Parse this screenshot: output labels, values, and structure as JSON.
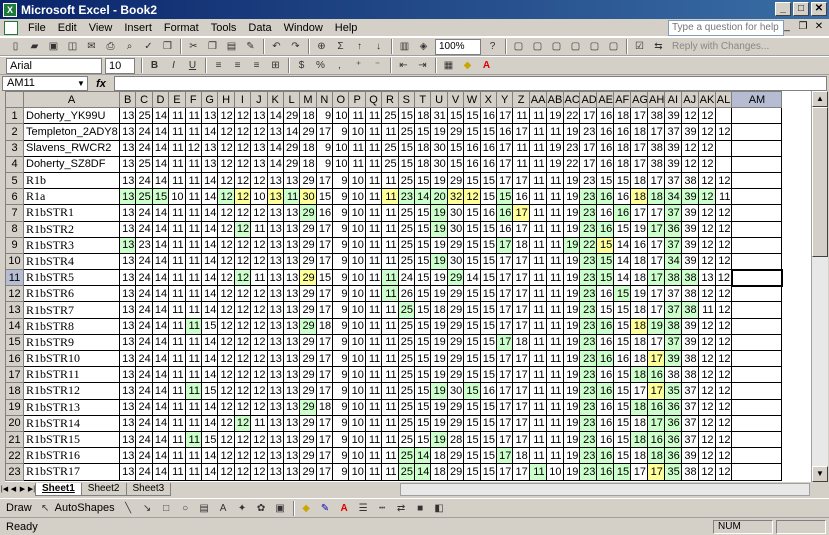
{
  "window": {
    "title": "Microsoft Excel - Book2"
  },
  "menu": [
    "File",
    "Edit",
    "View",
    "Insert",
    "Format",
    "Tools",
    "Data",
    "Window",
    "Help"
  ],
  "help_placeholder": "Type a question for help",
  "toolbar": {
    "zoom": "100%",
    "reply_label": "Reply with Changes...",
    "font": "Arial",
    "size": "10"
  },
  "formula": {
    "cell_ref": "AM11",
    "fx": "fx",
    "value": ""
  },
  "columns": [
    "A",
    "B",
    "C",
    "D",
    "E",
    "F",
    "G",
    "H",
    "I",
    "J",
    "K",
    "L",
    "M",
    "N",
    "O",
    "P",
    "Q",
    "R",
    "S",
    "T",
    "U",
    "V",
    "W",
    "X",
    "Y",
    "Z",
    "AA",
    "AB",
    "AC",
    "AD",
    "AE",
    "AF",
    "AG",
    "AH",
    "AI",
    "AJ",
    "AK",
    "AL",
    "AM"
  ],
  "rows": [
    {
      "n": "1",
      "name": "Doherty_YK99U",
      "v": [
        "13",
        "25",
        "14",
        "11",
        "11",
        "13",
        "12",
        "12",
        "13",
        "14",
        "29",
        "18",
        "9",
        "10",
        "11",
        "11",
        "25",
        "15",
        "18",
        "31",
        "15",
        "15",
        "16",
        "17",
        "11",
        "11",
        "19",
        "22",
        "17",
        "16",
        "18",
        "17",
        "38",
        "39",
        "12",
        "12"
      ]
    },
    {
      "n": "2",
      "name": "Templeton_2ADY8",
      "v": [
        "13",
        "24",
        "14",
        "11",
        "11",
        "14",
        "12",
        "12",
        "12",
        "13",
        "14",
        "29",
        "17",
        "9",
        "10",
        "11",
        "11",
        "25",
        "15",
        "19",
        "29",
        "15",
        "15",
        "16",
        "17",
        "11",
        "11",
        "19",
        "23",
        "16",
        "16",
        "18",
        "17",
        "37",
        "39",
        "12",
        "12"
      ]
    },
    {
      "n": "3",
      "name": "Slavens_RWCR2",
      "v": [
        "13",
        "24",
        "14",
        "11",
        "12",
        "13",
        "12",
        "12",
        "13",
        "14",
        "29",
        "18",
        "9",
        "10",
        "11",
        "11",
        "25",
        "15",
        "18",
        "30",
        "15",
        "16",
        "16",
        "17",
        "11",
        "11",
        "19",
        "23",
        "17",
        "16",
        "18",
        "17",
        "38",
        "39",
        "12",
        "12"
      ]
    },
    {
      "n": "4",
      "name": "Doherty_SZ8DF",
      "v": [
        "13",
        "25",
        "14",
        "11",
        "11",
        "13",
        "12",
        "12",
        "13",
        "14",
        "29",
        "18",
        "9",
        "10",
        "11",
        "11",
        "25",
        "15",
        "18",
        "30",
        "15",
        "16",
        "16",
        "17",
        "11",
        "11",
        "19",
        "22",
        "17",
        "16",
        "18",
        "17",
        "38",
        "39",
        "12",
        "12"
      ]
    },
    {
      "n": "5",
      "name": "R1b",
      "v": [
        "13",
        "24",
        "14",
        "11",
        "11",
        "14",
        "12",
        "12",
        "12",
        "13",
        "13",
        "29",
        "17",
        "9",
        "10",
        "11",
        "11",
        "25",
        "15",
        "19",
        "29",
        "15",
        "15",
        "17",
        "17",
        "11",
        "11",
        "19",
        "23",
        "15",
        "15",
        "18",
        "17",
        "37",
        "38",
        "12",
        "12"
      ]
    },
    {
      "n": "6",
      "name": "R1a",
      "v": [
        "13",
        "25",
        "15",
        "10",
        "11",
        "14",
        "12",
        "12",
        "10",
        "13",
        "11",
        "30",
        "15",
        "9",
        "10",
        "11",
        "11",
        "23",
        "14",
        "20",
        "32",
        "12",
        "15",
        "15",
        "16",
        "11",
        "11",
        "19",
        "23",
        "16",
        "16",
        "18",
        "18",
        "34",
        "39",
        "12",
        "11"
      ]
    },
    {
      "n": "7",
      "name": "R1bSTR1",
      "v": [
        "13",
        "24",
        "14",
        "11",
        "11",
        "14",
        "12",
        "12",
        "12",
        "13",
        "13",
        "29",
        "16",
        "9",
        "10",
        "11",
        "11",
        "25",
        "15",
        "19",
        "30",
        "15",
        "16",
        "16",
        "17",
        "11",
        "11",
        "19",
        "23",
        "16",
        "16",
        "17",
        "17",
        "37",
        "39",
        "12",
        "12"
      ]
    },
    {
      "n": "8",
      "name": "R1bSTR2",
      "v": [
        "13",
        "24",
        "14",
        "11",
        "11",
        "14",
        "12",
        "12",
        "11",
        "13",
        "13",
        "29",
        "17",
        "9",
        "10",
        "11",
        "11",
        "25",
        "15",
        "19",
        "30",
        "15",
        "15",
        "16",
        "17",
        "11",
        "11",
        "19",
        "23",
        "16",
        "15",
        "19",
        "17",
        "36",
        "39",
        "12",
        "12"
      ]
    },
    {
      "n": "9",
      "name": "R1bSTR3",
      "v": [
        "13",
        "23",
        "14",
        "11",
        "11",
        "14",
        "12",
        "12",
        "12",
        "13",
        "13",
        "29",
        "17",
        "9",
        "10",
        "11",
        "11",
        "25",
        "15",
        "19",
        "29",
        "15",
        "15",
        "17",
        "18",
        "11",
        "11",
        "19",
        "22",
        "15",
        "14",
        "16",
        "17",
        "37",
        "39",
        "12",
        "12"
      ]
    },
    {
      "n": "10",
      "name": "R1bSTR4",
      "v": [
        "13",
        "24",
        "14",
        "11",
        "11",
        "14",
        "12",
        "12",
        "12",
        "13",
        "13",
        "29",
        "17",
        "9",
        "10",
        "11",
        "11",
        "25",
        "15",
        "19",
        "30",
        "15",
        "15",
        "17",
        "17",
        "11",
        "11",
        "19",
        "23",
        "15",
        "14",
        "18",
        "17",
        "34",
        "39",
        "12",
        "12"
      ]
    },
    {
      "n": "11",
      "name": "R1bSTR5",
      "v": [
        "13",
        "24",
        "14",
        "11",
        "11",
        "14",
        "12",
        "12",
        "11",
        "13",
        "13",
        "29",
        "15",
        "9",
        "10",
        "11",
        "11",
        "24",
        "15",
        "19",
        "29",
        "14",
        "15",
        "17",
        "17",
        "11",
        "11",
        "19",
        "23",
        "15",
        "14",
        "18",
        "17",
        "38",
        "38",
        "13",
        "12"
      ]
    },
    {
      "n": "12",
      "name": "R1bSTR6",
      "v": [
        "13",
        "24",
        "14",
        "11",
        "11",
        "14",
        "12",
        "12",
        "12",
        "13",
        "13",
        "29",
        "17",
        "9",
        "10",
        "11",
        "11",
        "26",
        "15",
        "19",
        "29",
        "15",
        "15",
        "17",
        "17",
        "11",
        "11",
        "19",
        "23",
        "16",
        "15",
        "19",
        "17",
        "37",
        "38",
        "12",
        "12"
      ]
    },
    {
      "n": "13",
      "name": "R1bSTR7",
      "v": [
        "13",
        "24",
        "14",
        "11",
        "11",
        "14",
        "12",
        "12",
        "12",
        "13",
        "13",
        "29",
        "17",
        "9",
        "10",
        "11",
        "11",
        "25",
        "15",
        "18",
        "29",
        "15",
        "15",
        "17",
        "17",
        "11",
        "11",
        "19",
        "23",
        "15",
        "15",
        "18",
        "17",
        "37",
        "38",
        "11",
        "12"
      ]
    },
    {
      "n": "14",
      "name": "R1bSTR8",
      "v": [
        "13",
        "24",
        "14",
        "11",
        "11",
        "15",
        "12",
        "12",
        "12",
        "13",
        "13",
        "29",
        "18",
        "9",
        "10",
        "11",
        "11",
        "25",
        "15",
        "19",
        "29",
        "15",
        "15",
        "17",
        "17",
        "11",
        "11",
        "19",
        "23",
        "16",
        "15",
        "18",
        "19",
        "38",
        "39",
        "12",
        "12"
      ]
    },
    {
      "n": "15",
      "name": "R1bSTR9",
      "v": [
        "13",
        "24",
        "14",
        "11",
        "11",
        "14",
        "12",
        "12",
        "12",
        "13",
        "13",
        "29",
        "17",
        "9",
        "10",
        "11",
        "11",
        "25",
        "15",
        "19",
        "29",
        "15",
        "15",
        "17",
        "18",
        "11",
        "11",
        "19",
        "23",
        "16",
        "15",
        "18",
        "17",
        "37",
        "39",
        "12",
        "12"
      ]
    },
    {
      "n": "16",
      "name": "R1bSTR10",
      "v": [
        "13",
        "24",
        "14",
        "11",
        "11",
        "14",
        "12",
        "12",
        "12",
        "13",
        "13",
        "29",
        "17",
        "9",
        "10",
        "11",
        "11",
        "25",
        "15",
        "19",
        "29",
        "15",
        "15",
        "17",
        "17",
        "11",
        "11",
        "19",
        "23",
        "16",
        "16",
        "18",
        "17",
        "39",
        "38",
        "12",
        "12"
      ]
    },
    {
      "n": "17",
      "name": "R1bSTR11",
      "v": [
        "13",
        "24",
        "14",
        "11",
        "11",
        "14",
        "12",
        "12",
        "12",
        "13",
        "13",
        "29",
        "17",
        "9",
        "10",
        "11",
        "11",
        "25",
        "15",
        "19",
        "29",
        "15",
        "15",
        "17",
        "17",
        "11",
        "11",
        "19",
        "23",
        "16",
        "15",
        "18",
        "16",
        "38",
        "38",
        "12",
        "12"
      ]
    },
    {
      "n": "18",
      "name": "R1bSTR12",
      "v": [
        "13",
        "24",
        "14",
        "11",
        "11",
        "15",
        "12",
        "12",
        "12",
        "13",
        "13",
        "29",
        "17",
        "9",
        "10",
        "11",
        "11",
        "25",
        "15",
        "19",
        "30",
        "15",
        "16",
        "17",
        "17",
        "11",
        "11",
        "19",
        "23",
        "16",
        "15",
        "17",
        "17",
        "35",
        "37",
        "12",
        "12"
      ]
    },
    {
      "n": "19",
      "name": "R1bSTR13",
      "v": [
        "13",
        "24",
        "14",
        "11",
        "11",
        "14",
        "12",
        "12",
        "12",
        "13",
        "13",
        "29",
        "18",
        "9",
        "10",
        "11",
        "11",
        "25",
        "15",
        "19",
        "29",
        "15",
        "15",
        "17",
        "17",
        "11",
        "11",
        "19",
        "23",
        "16",
        "15",
        "18",
        "16",
        "36",
        "37",
        "12",
        "12"
      ]
    },
    {
      "n": "20",
      "name": "R1bSTR14",
      "v": [
        "13",
        "24",
        "14",
        "11",
        "11",
        "14",
        "12",
        "12",
        "11",
        "13",
        "13",
        "29",
        "17",
        "9",
        "10",
        "11",
        "11",
        "25",
        "15",
        "19",
        "29",
        "15",
        "15",
        "17",
        "17",
        "11",
        "11",
        "19",
        "23",
        "16",
        "15",
        "18",
        "17",
        "36",
        "37",
        "12",
        "12"
      ]
    },
    {
      "n": "21",
      "name": "R1bSTR15",
      "v": [
        "13",
        "24",
        "14",
        "11",
        "11",
        "15",
        "12",
        "12",
        "12",
        "13",
        "13",
        "29",
        "17",
        "9",
        "10",
        "11",
        "11",
        "25",
        "15",
        "19",
        "28",
        "15",
        "15",
        "17",
        "17",
        "11",
        "11",
        "19",
        "23",
        "16",
        "15",
        "18",
        "16",
        "36",
        "37",
        "12",
        "12"
      ]
    },
    {
      "n": "22",
      "name": "R1bSTR16",
      "v": [
        "13",
        "24",
        "14",
        "11",
        "11",
        "14",
        "12",
        "12",
        "12",
        "13",
        "13",
        "29",
        "17",
        "9",
        "10",
        "11",
        "11",
        "25",
        "14",
        "18",
        "29",
        "15",
        "15",
        "17",
        "18",
        "11",
        "11",
        "19",
        "23",
        "16",
        "15",
        "18",
        "18",
        "36",
        "39",
        "12",
        "12"
      ]
    },
    {
      "n": "23",
      "name": "R1bSTR17",
      "v": [
        "13",
        "24",
        "14",
        "11",
        "11",
        "14",
        "12",
        "12",
        "12",
        "13",
        "13",
        "29",
        "17",
        "9",
        "10",
        "11",
        "11",
        "25",
        "14",
        "18",
        "29",
        "15",
        "15",
        "17",
        "17",
        "11",
        "10",
        "19",
        "23",
        "16",
        "15",
        "17",
        "17",
        "35",
        "38",
        "12",
        "12"
      ]
    }
  ],
  "highlights": {
    "green": [
      [
        5,
        1
      ],
      [
        5,
        2
      ],
      [
        5,
        3
      ],
      [
        5,
        7
      ],
      [
        5,
        11
      ],
      [
        5,
        18
      ],
      [
        5,
        19
      ],
      [
        5,
        20
      ],
      [
        5,
        24
      ],
      [
        5,
        29
      ],
      [
        5,
        30
      ],
      [
        5,
        33
      ],
      [
        5,
        34
      ],
      [
        5,
        35
      ],
      [
        5,
        36
      ],
      [
        6,
        12
      ],
      [
        6,
        20
      ],
      [
        6,
        24
      ],
      [
        6,
        25
      ],
      [
        6,
        29
      ],
      [
        6,
        31
      ],
      [
        6,
        34
      ],
      [
        7,
        8
      ],
      [
        7,
        20
      ],
      [
        7,
        29
      ],
      [
        7,
        30
      ],
      [
        7,
        33
      ],
      [
        7,
        34
      ],
      [
        8,
        1
      ],
      [
        8,
        24
      ],
      [
        8,
        28
      ],
      [
        8,
        29
      ],
      [
        8,
        34
      ],
      [
        9,
        20
      ],
      [
        9,
        29
      ],
      [
        9,
        30
      ],
      [
        9,
        34
      ],
      [
        10,
        8
      ],
      [
        10,
        17
      ],
      [
        10,
        21
      ],
      [
        10,
        29
      ],
      [
        10,
        30
      ],
      [
        10,
        33
      ],
      [
        10,
        34
      ],
      [
        10,
        35
      ],
      [
        11,
        17
      ],
      [
        11,
        29
      ],
      [
        11,
        31
      ],
      [
        12,
        18
      ],
      [
        12,
        29
      ],
      [
        12,
        34
      ],
      [
        12,
        35
      ],
      [
        13,
        5
      ],
      [
        13,
        12
      ],
      [
        13,
        29
      ],
      [
        13,
        30
      ],
      [
        13,
        33
      ],
      [
        13,
        34
      ],
      [
        14,
        24
      ],
      [
        14,
        29
      ],
      [
        14,
        34
      ],
      [
        15,
        29
      ],
      [
        15,
        30
      ],
      [
        15,
        34
      ],
      [
        16,
        29
      ],
      [
        16,
        32
      ],
      [
        16,
        33
      ],
      [
        17,
        5
      ],
      [
        17,
        20
      ],
      [
        17,
        22
      ],
      [
        17,
        29
      ],
      [
        17,
        30
      ],
      [
        17,
        33
      ],
      [
        17,
        34
      ],
      [
        18,
        12
      ],
      [
        18,
        29
      ],
      [
        18,
        32
      ],
      [
        18,
        33
      ],
      [
        18,
        34
      ],
      [
        19,
        8
      ],
      [
        19,
        29
      ],
      [
        19,
        33
      ],
      [
        19,
        34
      ],
      [
        20,
        5
      ],
      [
        20,
        20
      ],
      [
        20,
        29
      ],
      [
        20,
        32
      ],
      [
        20,
        33
      ],
      [
        20,
        34
      ],
      [
        21,
        18
      ],
      [
        21,
        19
      ],
      [
        21,
        24
      ],
      [
        21,
        29
      ],
      [
        21,
        30
      ],
      [
        21,
        33
      ],
      [
        21,
        34
      ],
      [
        22,
        18
      ],
      [
        22,
        19
      ],
      [
        22,
        26
      ],
      [
        22,
        29
      ],
      [
        22,
        30
      ],
      [
        22,
        31
      ],
      [
        22,
        34
      ]
    ],
    "yellow": [
      [
        5,
        8
      ],
      [
        5,
        10
      ],
      [
        5,
        12
      ],
      [
        5,
        17
      ],
      [
        5,
        21
      ],
      [
        5,
        22
      ],
      [
        5,
        32
      ],
      [
        6,
        25
      ],
      [
        8,
        30
      ],
      [
        10,
        12
      ],
      [
        13,
        32
      ],
      [
        15,
        33
      ],
      [
        17,
        33
      ],
      [
        22,
        33
      ]
    ]
  },
  "sheets": [
    "Sheet1",
    "Sheet2",
    "Sheet3"
  ],
  "active_sheet": "Sheet1",
  "drawbar": {
    "draw": "Draw",
    "autoshapes": "AutoShapes"
  },
  "status": {
    "ready": "Ready",
    "num": "NUM"
  },
  "colors": {
    "green": "#ccffcc",
    "yellow": "#ffff99",
    "title": "#0a246a"
  }
}
